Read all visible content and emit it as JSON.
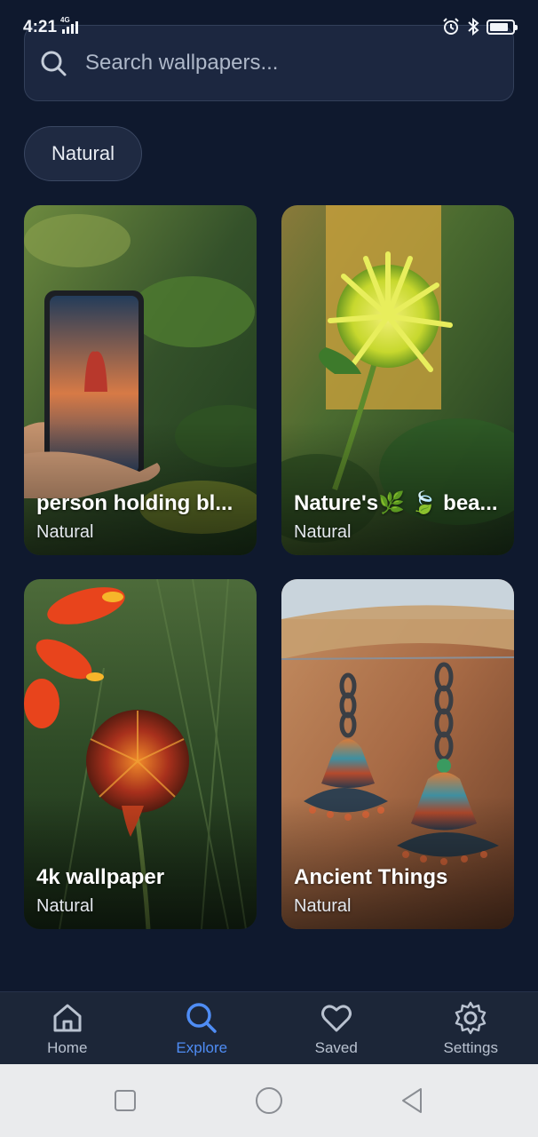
{
  "status_bar": {
    "time": "4:21",
    "network": "4G",
    "icons": [
      "alarm-icon",
      "bluetooth-icon",
      "battery-icon"
    ],
    "battery_level": 0.85
  },
  "search": {
    "placeholder": "Search wallpapers..."
  },
  "filter_chip": {
    "label": "Natural"
  },
  "wallpapers": [
    {
      "title": "person holding bl...",
      "category": "Natural"
    },
    {
      "title": "Nature's🌿 🍃 bea...",
      "category": "Natural"
    },
    {
      "title": "4k wallpaper",
      "category": "Natural"
    },
    {
      "title": "Ancient Things",
      "category": "Natural"
    }
  ],
  "bottom_nav": {
    "items": [
      {
        "label": "Home",
        "icon": "home-icon",
        "active": false
      },
      {
        "label": "Explore",
        "icon": "search-icon",
        "active": true
      },
      {
        "label": "Saved",
        "icon": "heart-icon",
        "active": false
      },
      {
        "label": "Settings",
        "icon": "gear-icon",
        "active": false
      }
    ]
  },
  "colors": {
    "background": "#0f192e",
    "accent": "#4f8df5",
    "nav_background": "#1c2638"
  }
}
